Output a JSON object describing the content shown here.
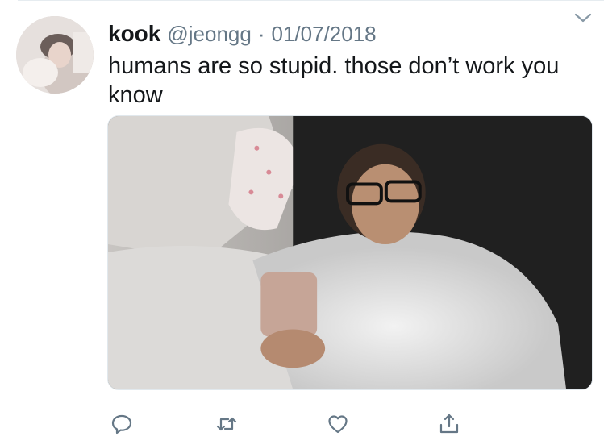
{
  "tweet": {
    "author": {
      "display_name": "kook",
      "handle": "@jeongg",
      "separator": "·",
      "date": "01/07/2018"
    },
    "text": "humans are so stupid. those don’t work you know",
    "media": {
      "kind": "photo"
    },
    "actions": [
      {
        "icon": "reply-icon"
      },
      {
        "icon": "retweet-icon"
      },
      {
        "icon": "like-icon"
      },
      {
        "icon": "share-icon"
      }
    ],
    "colors": {
      "text": "#14171a",
      "secondary": "#657786",
      "action_icon": "#657786",
      "divider": "#e6ecf0"
    }
  }
}
